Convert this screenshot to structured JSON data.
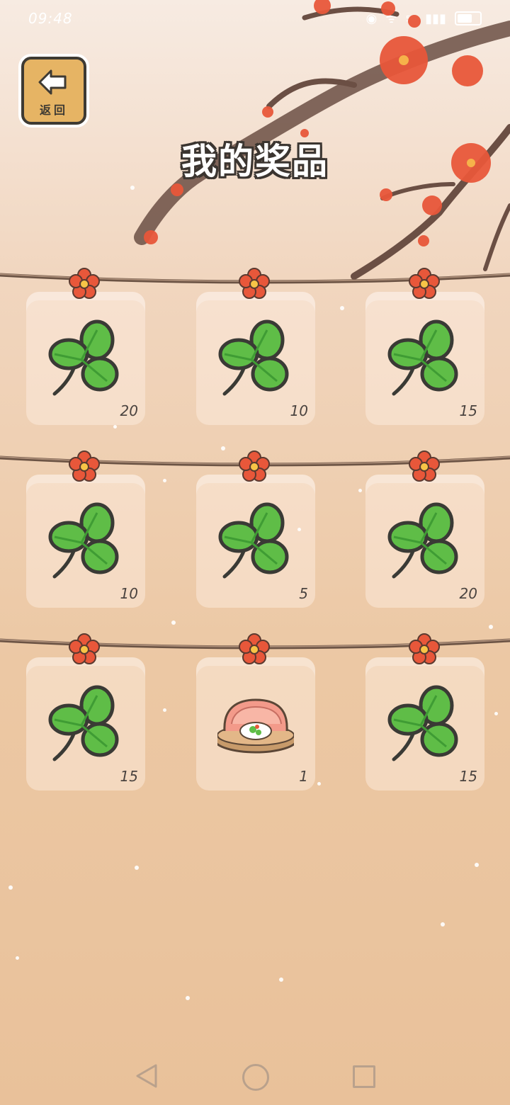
{
  "status_bar": {
    "time": "09:48",
    "net_label": "5G"
  },
  "back_button": {
    "label": "返回",
    "icon": "left-arrow-icon"
  },
  "title": "我的奖品",
  "prizes": [
    {
      "icon": "clover-icon",
      "count": "20"
    },
    {
      "icon": "clover-icon",
      "count": "10"
    },
    {
      "icon": "clover-icon",
      "count": "15"
    },
    {
      "icon": "clover-icon",
      "count": "10"
    },
    {
      "icon": "clover-icon",
      "count": "5"
    },
    {
      "icon": "clover-icon",
      "count": "20"
    },
    {
      "icon": "clover-icon",
      "count": "15"
    },
    {
      "icon": "shrimp-dish-icon",
      "count": "1"
    },
    {
      "icon": "clover-icon",
      "count": "15"
    }
  ],
  "colors": {
    "clover": "#5fbd47",
    "clover_outline": "#3a3a35",
    "rope": "#6b5344",
    "flower": "#e8573a",
    "button": "#e6b464"
  },
  "nav_bar": {
    "back_icon": "triangle-back-icon",
    "home_icon": "circle-home-icon",
    "recents_icon": "square-recents-icon"
  }
}
